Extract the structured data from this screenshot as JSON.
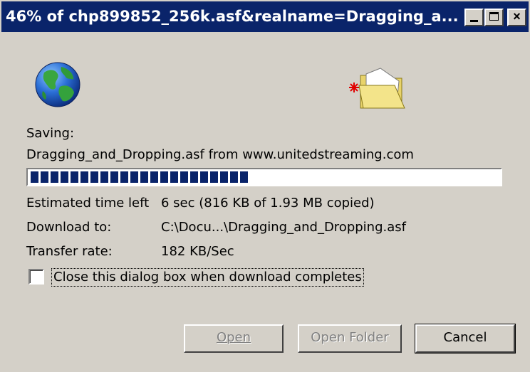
{
  "window": {
    "title": "46% of chp899852_256k.asf&realname=Dragging_a...",
    "controls": {
      "minimize": "minimize",
      "maximize": "maximize",
      "close": "×"
    }
  },
  "icons": {
    "globe": "globe-icon",
    "folder": "open-folder-icon"
  },
  "status": {
    "saving_label": "Saving:",
    "saving_detail": "Dragging_and_Dropping.asf from www.unitedstreaming.com",
    "progress_percent": 46
  },
  "details": {
    "time_label": "Estimated time left",
    "time_value": "6 sec (816 KB of 1.93 MB copied)",
    "download_label": "Download to:",
    "download_value": "C:\\Docu...\\Dragging_and_Dropping.asf",
    "rate_label": "Transfer rate:",
    "rate_value": "182 KB/Sec"
  },
  "options": {
    "close_when_done_label": "Close this dialog box when download completes",
    "close_when_done_checked": false
  },
  "buttons": {
    "open": "Open",
    "open_folder": "Open Folder",
    "cancel": "Cancel"
  },
  "colors": {
    "titlebar": "#0a246a",
    "progress": "#0a246a",
    "face": "#d4d0c8"
  }
}
